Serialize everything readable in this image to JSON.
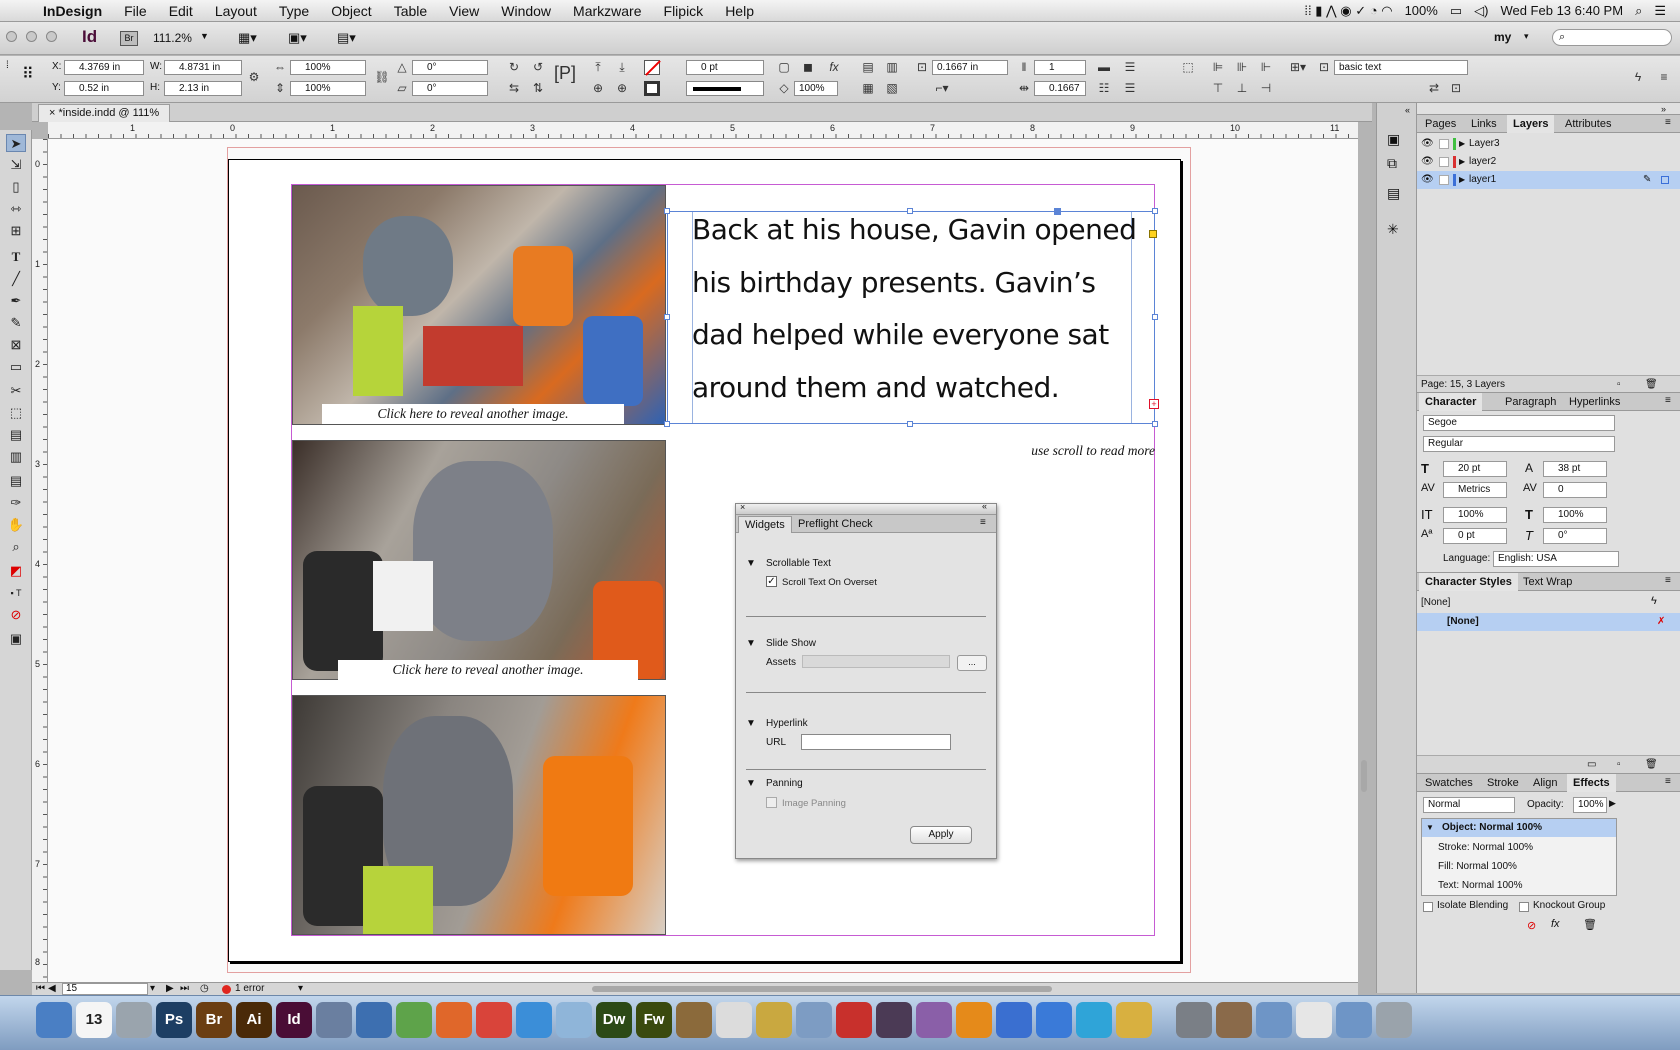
{
  "menubar": {
    "app": "InDesign",
    "items": [
      "File",
      "Edit",
      "Layout",
      "Type",
      "Object",
      "Table",
      "View",
      "Window",
      "Markzware",
      "Flipick",
      "Help"
    ],
    "battery": "100%",
    "clock": "Wed Feb 13  6:40 PM"
  },
  "app_bar": {
    "app_short": "Id",
    "bridge": "Br",
    "zoom": "111.2%",
    "workspace": "my"
  },
  "control": {
    "x_label": "X:",
    "x": "4.3769 in",
    "y_label": "Y:",
    "y": "0.52 in",
    "w_label": "W:",
    "w": "4.8731 in",
    "h_label": "H:",
    "h": "2.13 in",
    "scale_x": "100%",
    "scale_y": "100%",
    "rotate": "0°",
    "shear": "0°",
    "stroke_weight": "0 pt",
    "inset": "0.1667 in",
    "cols": "1",
    "gutter": "0.1667",
    "opacity": "100%",
    "style": "basic text"
  },
  "document": {
    "tab": "*inside.indd @ 111%",
    "ruler_h": [
      "1",
      "0",
      "1",
      "2",
      "3",
      "4",
      "5",
      "6",
      "7",
      "8",
      "9",
      "10",
      "11"
    ],
    "ruler_v": [
      "0",
      "1",
      "2",
      "3",
      "4",
      "5",
      "6",
      "7",
      "8"
    ],
    "story": "Back at his house, Gavin opened his birthday presents. Gavin’s dad helped while everyone sat around them and watched.",
    "scroll_hint": "use scroll to read more",
    "captions": [
      "Click here to reveal another image.",
      "Click here to reveal another image."
    ]
  },
  "widgets_panel": {
    "tabs": [
      "Widgets",
      "Preflight Check"
    ],
    "scrollable_text": "Scrollable Text",
    "scroll_overset": "Scroll Text On Overset",
    "slide_show": "Slide Show",
    "assets": "Assets",
    "assets_btn": "...",
    "hyperlink": "Hyperlink",
    "url": "URL",
    "panning": "Panning",
    "image_panning": "Image Panning",
    "apply": "Apply"
  },
  "layers_panel": {
    "tabs": [
      "Pages",
      "Links",
      "Layers",
      "Attributes"
    ],
    "layers": [
      "Layer3",
      "layer2",
      "layer1"
    ],
    "footer": "Page: 15, 3 Layers"
  },
  "character_panel": {
    "tabs": [
      "Character",
      "Paragraph",
      "Hyperlinks"
    ],
    "font": "Segoe",
    "style": "Regular",
    "size": "20 pt",
    "leading": "38 pt",
    "kerning": "Metrics",
    "tracking": "0",
    "vscale": "100%",
    "hscale": "100%",
    "baseline": "0 pt",
    "skew": "0°",
    "language_label": "Language:",
    "language": "English: USA"
  },
  "char_styles_panel": {
    "tabs": [
      "Character Styles",
      "Text Wrap"
    ],
    "current": "[None]",
    "item": "[None]"
  },
  "effects_panel": {
    "tabs": [
      "Swatches",
      "Stroke",
      "Align",
      "Effects"
    ],
    "blend": "Normal",
    "opacity_label": "Opacity:",
    "opacity": "100%",
    "rows": [
      "Object: Normal 100%",
      "Stroke:  Normal 100%",
      "Fill:  Normal 100%",
      "Text:  Normal 100%"
    ],
    "isolate": "Isolate Blending",
    "knockout": "Knockout Group"
  },
  "status": {
    "page": "15",
    "errors": "1 error"
  },
  "dock": [
    {
      "label": "",
      "color": "#4a7fc4"
    },
    {
      "label": "13",
      "color": "#f5f5f5"
    },
    {
      "label": "",
      "color": "#9aa4ad"
    },
    {
      "label": "Ps",
      "color": "#1d3e63"
    },
    {
      "label": "Br",
      "color": "#6b3e12"
    },
    {
      "label": "Ai",
      "color": "#4a2a08"
    },
    {
      "label": "Id",
      "color": "#4a0d36"
    },
    {
      "label": "",
      "color": "#6a7fa0"
    },
    {
      "label": "",
      "color": "#3d6fb0"
    },
    {
      "label": "",
      "color": "#5ea34a"
    },
    {
      "label": "",
      "color": "#e0672a"
    },
    {
      "label": "",
      "color": "#d9443a"
    },
    {
      "label": "",
      "color": "#3b8ed8"
    },
    {
      "label": "",
      "color": "#8fb5d9"
    },
    {
      "label": "Dw",
      "color": "#2c4a16"
    },
    {
      "label": "Fw",
      "color": "#3a4a0e"
    },
    {
      "label": "",
      "color": "#8b6a3b"
    },
    {
      "label": "",
      "color": "#dcdcdc"
    },
    {
      "label": "",
      "color": "#c9a840"
    },
    {
      "label": "",
      "color": "#7d9cc3"
    },
    {
      "label": "",
      "color": "#c8302c"
    },
    {
      "label": "",
      "color": "#4b3a55"
    },
    {
      "label": "",
      "color": "#8a5fa8"
    },
    {
      "label": "",
      "color": "#e58a1a"
    },
    {
      "label": "",
      "color": "#3a6fd0"
    },
    {
      "label": "",
      "color": "#3a7ad8"
    },
    {
      "label": "",
      "color": "#2fa4d8"
    },
    {
      "label": "",
      "color": "#d8b040"
    },
    {
      "label": "",
      "color": "#7a7f86"
    },
    {
      "label": "",
      "color": "#8a6a4a"
    },
    {
      "label": "",
      "color": "#6e95c6"
    },
    {
      "label": "",
      "color": "#e6e6e6"
    },
    {
      "label": "",
      "color": "#6e95c6"
    },
    {
      "label": "",
      "color": "#9aa3ab"
    }
  ]
}
